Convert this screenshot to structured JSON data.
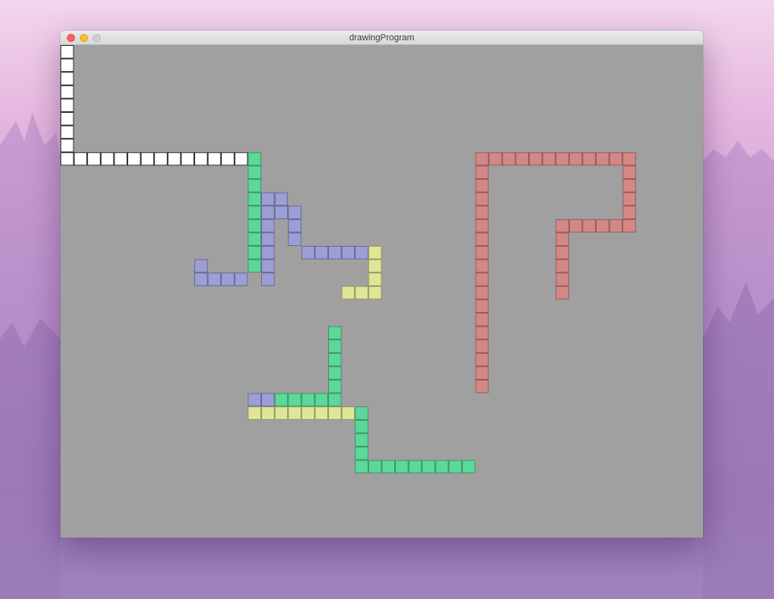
{
  "window": {
    "title": "drawingProgram"
  },
  "canvas": {
    "background": "#a0a0a0",
    "cell_border": "#555555",
    "strokes": [
      {
        "color": "#ffffff",
        "border": "#111111",
        "cells": [
          [
            0,
            0
          ],
          [
            0,
            1
          ],
          [
            0,
            2
          ],
          [
            0,
            3
          ],
          [
            0,
            4
          ],
          [
            0,
            5
          ],
          [
            0,
            6
          ],
          [
            0,
            7
          ],
          [
            0,
            8
          ],
          [
            1,
            8
          ],
          [
            2,
            8
          ],
          [
            3,
            8
          ],
          [
            4,
            8
          ],
          [
            5,
            8
          ],
          [
            6,
            8
          ],
          [
            7,
            8
          ],
          [
            8,
            8
          ],
          [
            9,
            8
          ],
          [
            10,
            8
          ],
          [
            11,
            8
          ],
          [
            12,
            8
          ],
          [
            13,
            8
          ]
        ]
      },
      {
        "color": "#5bd99a",
        "border": "#3a8a5e",
        "cells": [
          [
            14,
            8
          ],
          [
            14,
            9
          ],
          [
            14,
            10
          ],
          [
            14,
            11
          ],
          [
            14,
            12
          ],
          [
            14,
            13
          ],
          [
            14,
            14
          ],
          [
            14,
            15
          ],
          [
            14,
            16
          ]
        ]
      },
      {
        "color": "#9c9fd6",
        "border": "#5d5f8c",
        "cells": [
          [
            15,
            11
          ],
          [
            16,
            11
          ],
          [
            15,
            12
          ],
          [
            16,
            12
          ],
          [
            17,
            12
          ],
          [
            15,
            13
          ],
          [
            17,
            13
          ],
          [
            15,
            14
          ],
          [
            17,
            14
          ],
          [
            15,
            15
          ],
          [
            18,
            15
          ],
          [
            19,
            15
          ],
          [
            20,
            15
          ],
          [
            21,
            15
          ],
          [
            22,
            15
          ],
          [
            15,
            16
          ],
          [
            15,
            17
          ],
          [
            10,
            16
          ],
          [
            10,
            17
          ],
          [
            11,
            17
          ],
          [
            12,
            17
          ],
          [
            13,
            17
          ]
        ]
      },
      {
        "color": "#dfe796",
        "border": "#8e9358",
        "cells": [
          [
            23,
            15
          ],
          [
            23,
            16
          ],
          [
            23,
            17
          ],
          [
            23,
            18
          ],
          [
            21,
            18
          ],
          [
            22,
            18
          ]
        ]
      },
      {
        "color": "#d48787",
        "border": "#8c5252",
        "cells": [
          [
            31,
            8
          ],
          [
            32,
            8
          ],
          [
            33,
            8
          ],
          [
            34,
            8
          ],
          [
            35,
            8
          ],
          [
            36,
            8
          ],
          [
            37,
            8
          ],
          [
            38,
            8
          ],
          [
            39,
            8
          ],
          [
            40,
            8
          ],
          [
            41,
            8
          ],
          [
            42,
            8
          ],
          [
            31,
            9
          ],
          [
            31,
            10
          ],
          [
            31,
            11
          ],
          [
            31,
            12
          ],
          [
            31,
            13
          ],
          [
            31,
            14
          ],
          [
            31,
            15
          ],
          [
            31,
            16
          ],
          [
            31,
            17
          ],
          [
            31,
            18
          ],
          [
            31,
            19
          ],
          [
            31,
            20
          ],
          [
            31,
            21
          ],
          [
            31,
            22
          ],
          [
            31,
            23
          ],
          [
            31,
            24
          ],
          [
            31,
            25
          ],
          [
            42,
            9
          ],
          [
            42,
            10
          ],
          [
            42,
            11
          ],
          [
            42,
            12
          ],
          [
            42,
            13
          ],
          [
            37,
            13
          ],
          [
            38,
            13
          ],
          [
            39,
            13
          ],
          [
            40,
            13
          ],
          [
            41,
            13
          ],
          [
            37,
            14
          ],
          [
            37,
            15
          ],
          [
            37,
            16
          ],
          [
            37,
            17
          ],
          [
            37,
            18
          ]
        ]
      },
      {
        "color": "#5bd99a",
        "border": "#3a8a5e",
        "cells": [
          [
            20,
            21
          ],
          [
            20,
            22
          ],
          [
            20,
            23
          ],
          [
            20,
            24
          ],
          [
            20,
            25
          ],
          [
            20,
            26
          ],
          [
            16,
            26
          ],
          [
            17,
            26
          ],
          [
            18,
            26
          ],
          [
            19,
            26
          ]
        ]
      },
      {
        "color": "#9c9fd6",
        "border": "#5d5f8c",
        "cells": [
          [
            14,
            26
          ],
          [
            15,
            26
          ]
        ]
      },
      {
        "color": "#dfe796",
        "border": "#8e9358",
        "cells": [
          [
            14,
            27
          ],
          [
            15,
            27
          ],
          [
            16,
            27
          ],
          [
            17,
            27
          ],
          [
            18,
            27
          ],
          [
            19,
            27
          ],
          [
            20,
            27
          ],
          [
            21,
            27
          ]
        ]
      },
      {
        "color": "#5bd99a",
        "border": "#3a8a5e",
        "cells": [
          [
            22,
            27
          ],
          [
            22,
            28
          ],
          [
            22,
            29
          ],
          [
            22,
            30
          ],
          [
            22,
            31
          ],
          [
            23,
            31
          ],
          [
            24,
            31
          ],
          [
            25,
            31
          ],
          [
            26,
            31
          ],
          [
            27,
            31
          ],
          [
            28,
            31
          ],
          [
            29,
            31
          ],
          [
            30,
            31
          ]
        ]
      }
    ]
  }
}
